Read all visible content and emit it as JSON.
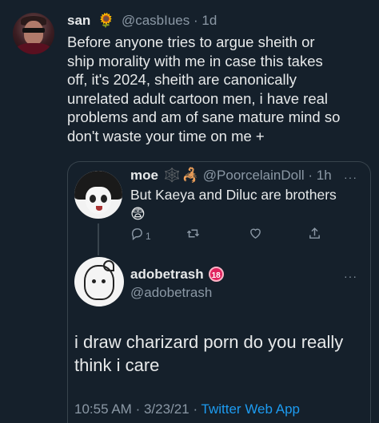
{
  "main_tweet": {
    "display_name": "san",
    "badge_emoji": "🌻",
    "handle": "@casbIues",
    "separator": "·",
    "time": "1d",
    "lines": [
      "Before anyone tries to argue sheith or",
      "ship morality with me in case this takes",
      "off, it's 2024, sheith are canonically",
      "unrelated adult cartoon men, i have real",
      "problems and am of sane mature mind so",
      "don't waste your time on me +"
    ]
  },
  "quoted_reply": {
    "display_name": "moe",
    "name_emojis": "🕸️",
    "name_emoji_2": "🦂",
    "handle": "@PoorcelainDoll",
    "separator": "·",
    "time": "1h",
    "more": "···",
    "text": "But Kaeya and Diluc are brothers",
    "emoji": "😨",
    "reply_count": "1"
  },
  "quoted_original": {
    "display_name": "adobetrash",
    "badge": "18",
    "handle": "@adobetrash",
    "more": "···",
    "lines": [
      "i draw charizard porn do you really",
      "think i care"
    ],
    "time": "10:55 AM",
    "date": "3/23/21",
    "separator": "·",
    "source": "Twitter Web App"
  },
  "colors": {
    "background": "#15202b",
    "text": "#e7e9ea",
    "muted": "#8b98a5",
    "link": "#1d9bf0",
    "border": "#38444d",
    "badge": "#e0245e"
  }
}
